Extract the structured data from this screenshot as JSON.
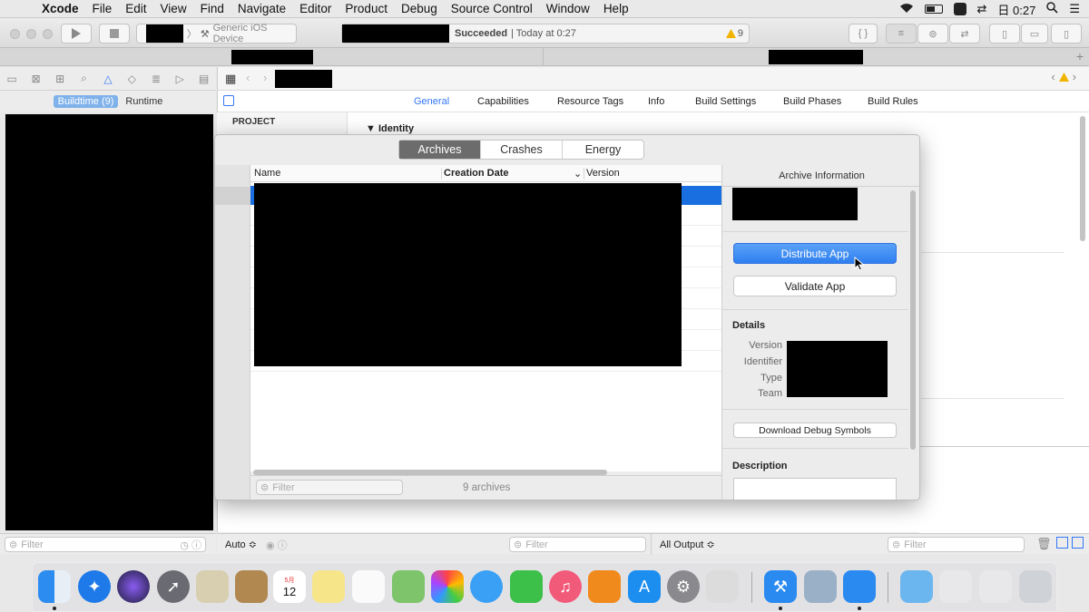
{
  "menubar": {
    "app_name": "Xcode",
    "items": [
      "File",
      "Edit",
      "View",
      "Find",
      "Navigate",
      "Editor",
      "Product",
      "Debug",
      "Source Control",
      "Window",
      "Help"
    ],
    "clock": "日 0:27"
  },
  "toolbar": {
    "scheme_device": "Generic iOS Device",
    "status_result": "Succeeded",
    "status_time": "| Today at 0:27",
    "warning_count": "9"
  },
  "navigator": {
    "segments": [
      "Buildtime (9)",
      "Runtime"
    ],
    "filter_placeholder": "Filter"
  },
  "editor": {
    "tabs": [
      "General",
      "Capabilities",
      "Resource Tags",
      "Info",
      "Build Settings",
      "Build Phases",
      "Build Rules"
    ],
    "project_label": "PROJECT",
    "section_identity": "Identity"
  },
  "debug": {
    "auto_label": "Auto ≎",
    "filter_placeholder": "Filter",
    "output_label": "All Output ≎"
  },
  "organizer": {
    "tabs": [
      "Archives",
      "Crashes",
      "Energy"
    ],
    "columns": {
      "name": "Name",
      "creation_date": "Creation Date",
      "version": "Version"
    },
    "filter_placeholder": "Filter",
    "archive_count": "9 archives",
    "info": {
      "header": "Archive Information",
      "distribute_button": "Distribute App",
      "validate_button": "Validate App",
      "details_title": "Details",
      "detail_labels": [
        "Version",
        "Identifier",
        "Type",
        "Team"
      ],
      "download_symbols_button": "Download Debug Symbols",
      "description_title": "Description"
    }
  },
  "dock": {
    "calendar_month": "5月",
    "calendar_day": "12"
  },
  "colors": {
    "accent": "#2f7ff0",
    "selection": "#1a6fe0",
    "warning": "#f0b400"
  }
}
